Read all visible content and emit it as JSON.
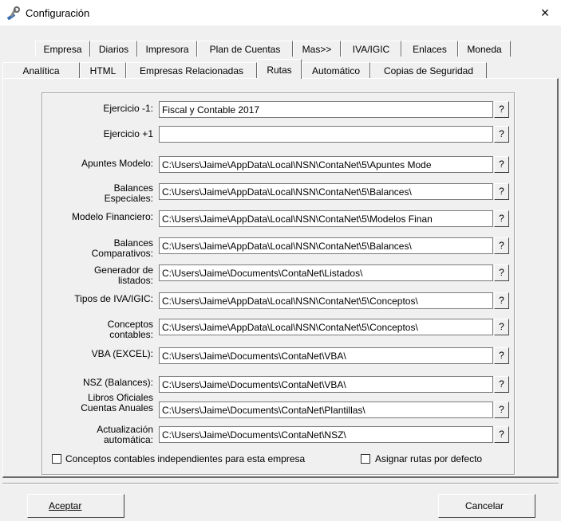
{
  "window": {
    "title": "Configuración",
    "close": "×"
  },
  "tabs_row1": [
    "Empresa",
    "Diarios",
    "Impresora",
    "Plan de Cuentas",
    "Mas>>",
    "IVA/IGIC",
    "Enlaces",
    "Moneda"
  ],
  "tabs_row2": [
    "Analítica",
    "HTML",
    "Empresas Relacionadas",
    "Rutas",
    "Automático",
    "Copias de Seguridad"
  ],
  "active_tab": "Rutas",
  "help_label": "?",
  "paths": [
    {
      "label": "Ejercicio -1:",
      "value": "Fiscal y Contable 2017"
    },
    {
      "label": "Ejercicio +1",
      "value": ""
    },
    {
      "label": "Apuntes Modelo:",
      "value": "C:\\Users\\Jaime\\AppData\\Local\\NSN\\ContaNet\\5\\Apuntes Mode"
    },
    {
      "label": "Balances Especiales:",
      "value": "C:\\Users\\Jaime\\AppData\\Local\\NSN\\ContaNet\\5\\Balances\\"
    },
    {
      "label": "Modelo Financiero:",
      "value": "C:\\Users\\Jaime\\AppData\\Local\\NSN\\ContaNet\\5\\Modelos Finan"
    },
    {
      "label": "Balances Comparativos:",
      "value": "C:\\Users\\Jaime\\AppData\\Local\\NSN\\ContaNet\\5\\Balances\\"
    },
    {
      "label": "Generador de listados:",
      "value": "C:\\Users\\Jaime\\Documents\\ContaNet\\Listados\\"
    },
    {
      "label": "Tipos de IVA/IGIC:",
      "value": "C:\\Users\\Jaime\\AppData\\Local\\NSN\\ContaNet\\5\\Conceptos\\"
    },
    {
      "label": "Conceptos contables:",
      "value": "C:\\Users\\Jaime\\AppData\\Local\\NSN\\ContaNet\\5\\Conceptos\\"
    },
    {
      "label": "VBA (EXCEL):",
      "value": "C:\\Users\\Jaime\\Documents\\ContaNet\\VBA\\"
    },
    {
      "label": "NSZ (Balances):",
      "value": "C:\\Users\\Jaime\\Documents\\ContaNet\\VBA\\"
    },
    {
      "label": "Libros Oficiales Cuentas Anuales",
      "value": "C:\\Users\\Jaime\\Documents\\ContaNet\\Plantillas\\"
    },
    {
      "label": "Actualización automática:",
      "value": "C:\\Users\\Jaime\\Documents\\ContaNet\\NSZ\\"
    }
  ],
  "checkboxes": {
    "independent": {
      "label": "Conceptos contables independientes para esta empresa",
      "checked": false
    },
    "default_paths": {
      "label": "Asignar rutas por defecto",
      "checked": false
    }
  },
  "buttons": {
    "accept": "Aceptar",
    "cancel": "Cancelar"
  }
}
